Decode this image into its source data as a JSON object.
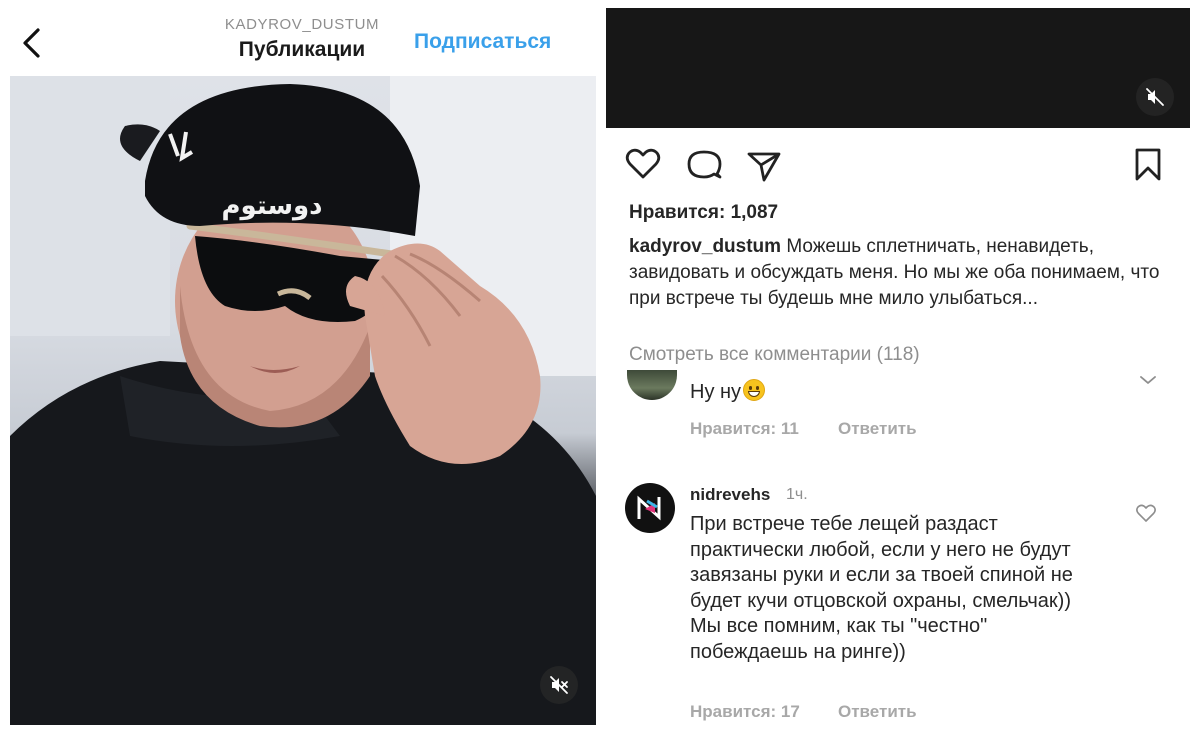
{
  "left_panel": {
    "header": {
      "username": "KADYROV_DUSTUM",
      "title": "Публикации",
      "follow_label": "Подписаться",
      "back_icon": "chevron-left-icon"
    },
    "photo": {
      "cap_text": "دوستوم",
      "mute_icon": "speaker-muted-icon"
    }
  },
  "right_panel": {
    "video": {
      "mute_icon": "speaker-muted-icon"
    },
    "actions": {
      "like_icon": "heart-icon",
      "comment_icon": "comment-icon",
      "share_icon": "send-icon",
      "save_icon": "bookmark-icon"
    },
    "likes": "Нравится: 1,087",
    "caption": {
      "username": "kadyrov_dustum",
      "text": "Можешь сплетничать, ненавидеть, завидовать и обсуждать меня. Но мы же оба понимаем, что при встрече ты будешь мне мило улыбаться..."
    },
    "view_all_comments": "Смотреть все комментарии (118)",
    "comments": [
      {
        "text": "Ну ну",
        "emoji": "grinning-face-emoji",
        "likes_label": "Нравится: 11",
        "reply_label": "Ответить"
      },
      {
        "username": "nidrevehs",
        "time": "1ч.",
        "text": "При встрече тебе лещей раздаст практически любой, если у него не будут завязаны руки и если за твоей спиной не будет кучи отцовской охраны, смельчак)) Мы все помним, как ты \"честно\" побеждаешь на ринге))",
        "likes_label": "Нравится: 17",
        "reply_label": "Ответить"
      }
    ]
  },
  "colors": {
    "link_blue": "#3aa0ea",
    "text_primary": "#262626",
    "text_secondary": "#8e8e8e",
    "meta_gray": "#a8a8a8"
  }
}
